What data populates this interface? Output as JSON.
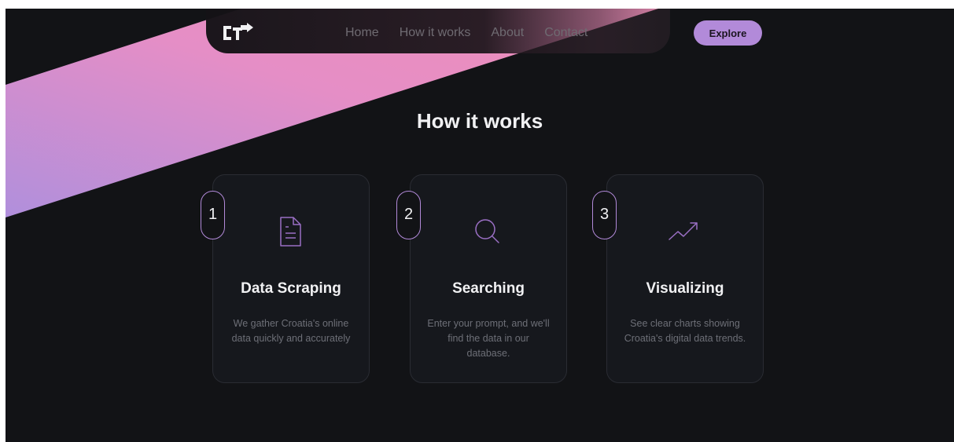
{
  "brand": {
    "logo_icon": "ct-arrow-logo-icon"
  },
  "nav": {
    "links": [
      "Home",
      "How it works",
      "About",
      "Contact"
    ],
    "explore_label": "Explore"
  },
  "section": {
    "title": "How it works"
  },
  "steps": [
    {
      "number": "1",
      "icon": "document-icon",
      "title": "Data Scraping",
      "description": "We gather Croatia's online data quickly and accurately"
    },
    {
      "number": "2",
      "icon": "search-icon",
      "title": "Searching",
      "description": "Enter your prompt, and we'll find the data in our database."
    },
    {
      "number": "3",
      "icon": "trending-up-icon",
      "title": "Visualizing",
      "description": "See clear charts showing Croatia's digital data trends."
    }
  ],
  "colors": {
    "background": "#121316",
    "accent": "#b28ad9",
    "stripe_start": "#b08fdc",
    "stripe_end": "#ef8fb8"
  }
}
